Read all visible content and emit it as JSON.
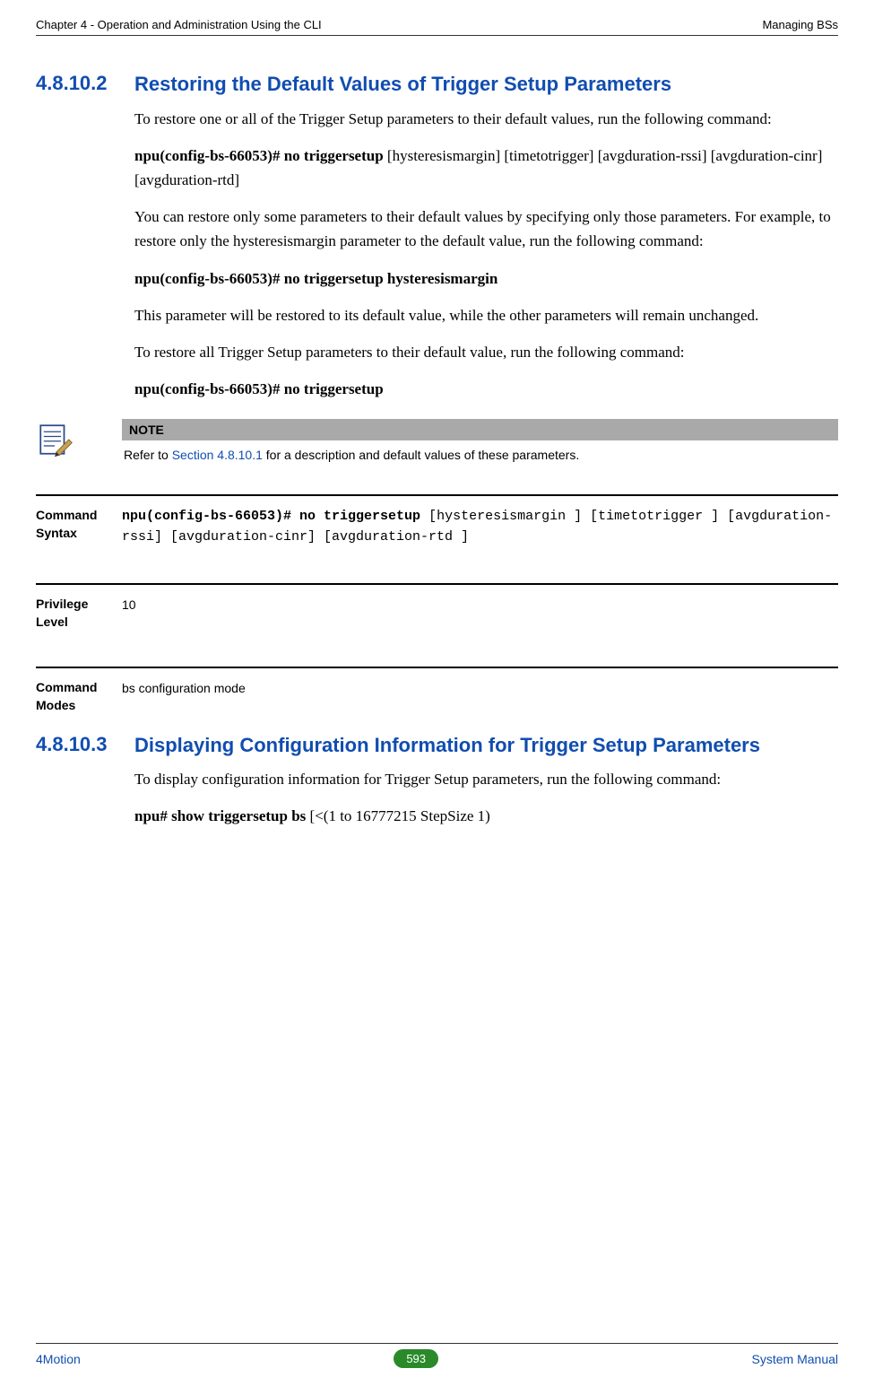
{
  "header": {
    "left": "Chapter 4 - Operation and Administration Using the CLI",
    "right": "Managing BSs"
  },
  "sections": {
    "s1": {
      "num": "4.8.10.2",
      "title": "Restoring the Default Values of Trigger Setup Parameters",
      "p1": "To restore one or all of the Trigger Setup parameters to their default values, run the following command:",
      "cmd1_bold": "npu(config-bs-66053)# no triggersetup",
      "cmd1_rest": " [hysteresismargin] [timetotrigger] [avgduration-rssi] [avgduration-cinr] [avgduration-rtd]",
      "p2": "You can restore only some parameters to their default values by specifying only those parameters. For example, to restore only the hysteresismargin parameter to the default value, run the following command:",
      "cmd2": "npu(config-bs-66053)# no triggersetup hysteresismargin",
      "p3": "This parameter will be restored to its default value, while the other parameters will remain unchanged.",
      "p4": "To restore all Trigger Setup parameters to their default value, run the following command:",
      "cmd3": "npu(config-bs-66053)# no triggersetup"
    },
    "note": {
      "label": "NOTE",
      "text_a": "Refer to ",
      "link": "Section 4.8.10.1",
      "text_b": " for a description and default values of these parameters."
    },
    "rows": {
      "syntax_label": "Command Syntax",
      "syntax_bold": "npu(config-bs-66053)# no triggersetup ",
      "syntax_rest": "[hysteresismargin ] [timetotrigger ] [avgduration-rssi] [avgduration-cinr] [avgduration-rtd ]",
      "priv_label": "Privilege Level",
      "priv_value": "10",
      "modes_label": "Command Modes",
      "modes_value": "bs configuration mode"
    },
    "s2": {
      "num": "4.8.10.3",
      "title": "Displaying Configuration Information for Trigger Setup Parameters",
      "p1": "To display configuration information for Trigger Setup parameters, run the following command:",
      "cmd_bold": "npu# show triggersetup bs",
      "cmd_rest": " [<(1 to 16777215 StepSize 1)"
    }
  },
  "footer": {
    "left": "4Motion",
    "page": "593",
    "right": "System Manual"
  }
}
